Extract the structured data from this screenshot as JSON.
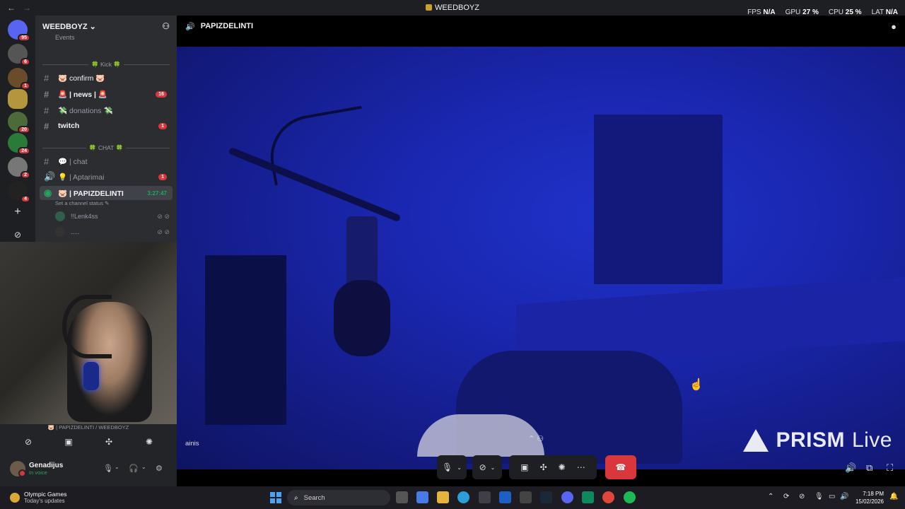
{
  "titlebar": {
    "title": "WEEDBOYZ",
    "back": "←",
    "forward": "→",
    "stats": [
      {
        "label": "FPS",
        "value": "N/A"
      },
      {
        "label": "GPU",
        "value": "27 %"
      },
      {
        "label": "CPU",
        "value": "25 %"
      },
      {
        "label": "LAT",
        "value": "N/A"
      }
    ]
  },
  "servers": [
    {
      "icon": "discord-home-icon",
      "badge": "95"
    },
    {
      "icon": "server-icon",
      "badge": "6"
    },
    {
      "icon": "server-icon",
      "badge": "1"
    },
    {
      "icon": "server-icon",
      "badge": ""
    },
    {
      "icon": "server-icon",
      "badge": "20"
    },
    {
      "icon": "server-icon",
      "badge": "24"
    },
    {
      "icon": "server-icon",
      "badge": "2"
    },
    {
      "icon": "server-icon",
      "badge": "4"
    }
  ],
  "guild": {
    "name": "WEEDBOYZ ⌄",
    "events_label": "Events",
    "categories": {
      "kick": "🍀 Kick 🍀",
      "chat": "🍀 CHAT 🍀"
    },
    "channels": [
      {
        "name": "🐷 confirm 🐷",
        "badge": ""
      },
      {
        "name": "🚨 | news | 🚨",
        "badge": "16"
      },
      {
        "name": "💸 donations 💸",
        "badge": ""
      },
      {
        "name": "twitch",
        "badge": "1"
      },
      {
        "name": "💬 | chat",
        "badge": ""
      },
      {
        "name": "💡 | Aptarimai",
        "badge": "1"
      },
      {
        "name": "🐷 | PAPIZDELINTI",
        "timer": "3:27:47"
      }
    ],
    "channel_status": "Set a channel status ✎",
    "voice_users": [
      {
        "name": "!!Lenk4ss"
      },
      {
        "name": "....."
      }
    ]
  },
  "voice_panel": {
    "location": "🐷 | PAPIZDELINTI / WEEDBOYZ",
    "user_name": "Genadijus",
    "user_status": "In voice"
  },
  "stage": {
    "channel_name": "PAPIZDELINTI",
    "streamer_label": "ainis",
    "watermark_brand": "PRISM",
    "watermark_live": "Live"
  },
  "taskbar": {
    "weather_title": "Olympic Games",
    "weather_sub": "Today's updates",
    "search_placeholder": "Search",
    "time": "7:18 PM",
    "date": "15/02/2026"
  },
  "colors": {
    "accent_red": "#da373c",
    "online_green": "#23a55a",
    "sidebar_bg": "#2b2d31",
    "video_blue": "#1a27b0"
  }
}
